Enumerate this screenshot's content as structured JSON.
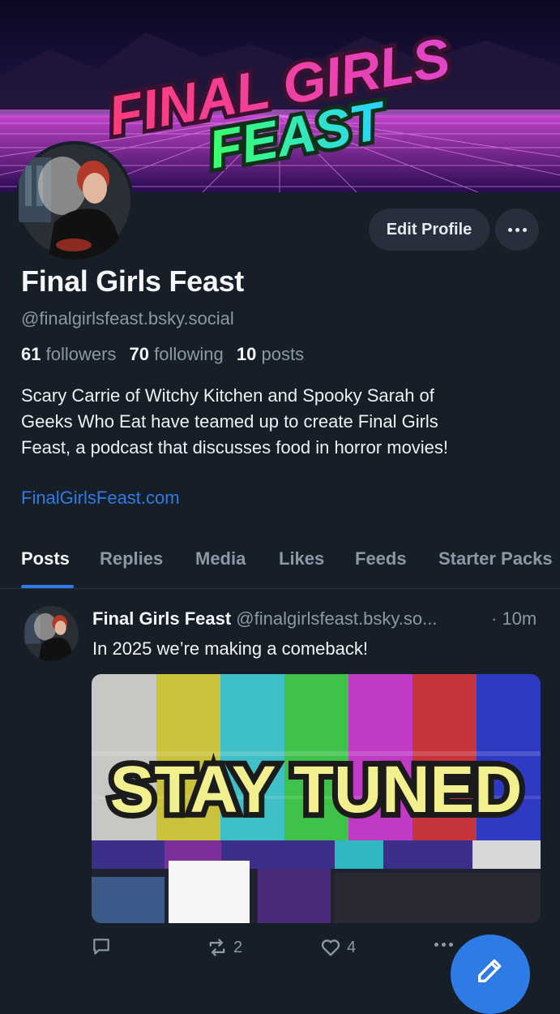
{
  "banner": {
    "logo_line1": "FINAL GIRLS",
    "logo_line2": "FEAST"
  },
  "profile": {
    "display_name": "Final Girls Feast",
    "handle": "@finalgirlsfeast.bsky.social",
    "followers_count": "61",
    "followers_label": "followers",
    "following_count": "70",
    "following_label": "following",
    "posts_count": "10",
    "posts_label": "posts",
    "bio_lines": [
      "Scary Carrie of Witchy Kitchen and Spooky Sarah of",
      "Geeks Who Eat have teamed up to create Final Girls",
      "Feast, a podcast that discusses food in horror movies!"
    ],
    "website": "FinalGirlsFeast.com"
  },
  "actions": {
    "edit_profile": "Edit Profile",
    "more_icon": "ellipsis-icon"
  },
  "tabs": [
    {
      "label": "Posts",
      "active": true
    },
    {
      "label": "Replies"
    },
    {
      "label": "Media"
    },
    {
      "label": "Likes"
    },
    {
      "label": "Feeds"
    },
    {
      "label": "Starter Packs"
    }
  ],
  "post": {
    "author": "Final Girls Feast",
    "handle": "@finalgirlsfeast.bsky.so...",
    "time": "· 10m",
    "text": "In 2025 we’re making a comeback!",
    "image_text": "STAY TUNED",
    "reply_count": "",
    "repost_count": "2",
    "like_count": "4"
  },
  "colors": {
    "background": "#161e27",
    "accent": "#2f7be5",
    "muted_text": "#8c98a6",
    "button_bg": "#262f3b"
  }
}
